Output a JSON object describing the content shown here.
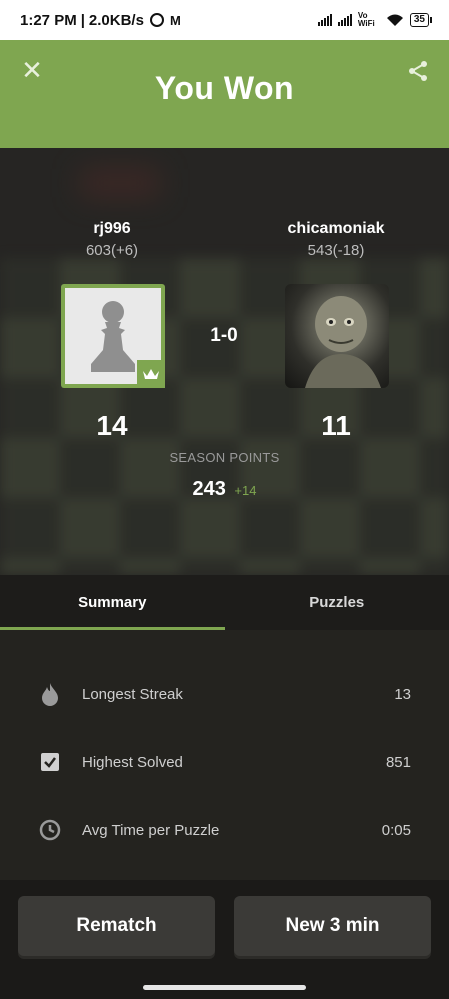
{
  "status_bar": {
    "time": "1:27 PM",
    "speed": "2.0KB/s",
    "battery": "35",
    "network_label": "Vo WiFi"
  },
  "header": {
    "title": "You Won",
    "close_icon": "close-icon",
    "share_icon": "share-icon",
    "color": "#7fa650"
  },
  "players": {
    "left": {
      "name": "rj996",
      "rating": "603(+6)",
      "points": "14"
    },
    "right": {
      "name": "chicamoniak",
      "rating": "543(-18)",
      "points": "11"
    }
  },
  "result": "1-0",
  "season": {
    "label": "SEASON POINTS",
    "value": "243",
    "delta": "+14"
  },
  "tabs": [
    {
      "label": "Summary",
      "active": true
    },
    {
      "label": "Puzzles",
      "active": false
    }
  ],
  "stats": [
    {
      "icon": "flame-icon",
      "label": "Longest Streak",
      "value": "13"
    },
    {
      "icon": "checkbox-icon",
      "label": "Highest Solved",
      "value": "851"
    },
    {
      "icon": "clock-icon",
      "label": "Avg Time per Puzzle",
      "value": "0:05"
    }
  ],
  "buttons": {
    "rematch": "Rematch",
    "new_game": "New 3 min"
  }
}
